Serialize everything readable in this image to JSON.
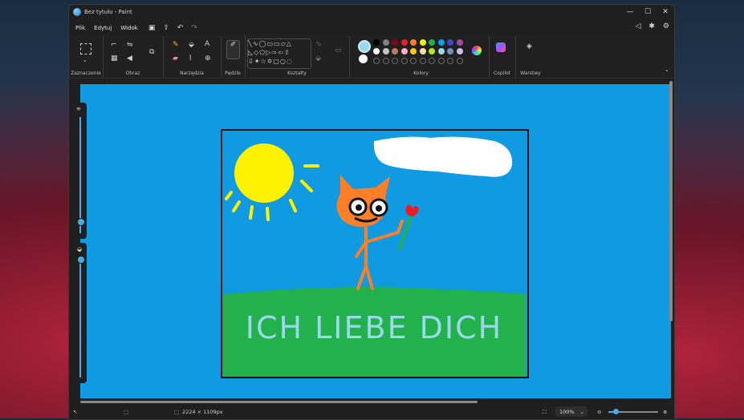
{
  "window": {
    "title": "Bez tytułu - Paint",
    "min_icon": "minimize-icon",
    "max_icon": "maximize-icon",
    "close_icon": "close-icon"
  },
  "menu": {
    "items": [
      "Plik",
      "Edytuj",
      "Widok"
    ]
  },
  "ribbon": {
    "groups": [
      {
        "label": "Zaznaczenie"
      },
      {
        "label": "Obraz"
      },
      {
        "label": "Narzędzia"
      },
      {
        "label": "Pędzle"
      },
      {
        "label": "Kształty"
      },
      {
        "label": "Kolory"
      },
      {
        "label": "Copilot"
      },
      {
        "label": "Warstwy"
      }
    ],
    "colors_row1": [
      "#000000",
      "#7f7f7f",
      "#880015",
      "#ed1c24",
      "#ff7f27",
      "#fff200",
      "#22b14c",
      "#00a2e8",
      "#3f48cc",
      "#a349a4"
    ],
    "colors_row2": [
      "#ffffff",
      "#c3c3c3",
      "#b97a57",
      "#ffaec9",
      "#ffc90e",
      "#efe4b0",
      "#b5e61d",
      "#99d9ea",
      "#7092be",
      "#c8bfe7"
    ],
    "active_color": "#99d9ea",
    "secondary_color": "#ffffff"
  },
  "drawing": {
    "caption": "ICH LIEBE DICH",
    "sky": "#0f9ae2",
    "grass": "#22b14c",
    "sun": "#fff200",
    "cat": "#ff7f27",
    "text_color": "#99d9ea"
  },
  "status": {
    "canvas_size": "2224 × 1109px",
    "zoom": "100%"
  }
}
